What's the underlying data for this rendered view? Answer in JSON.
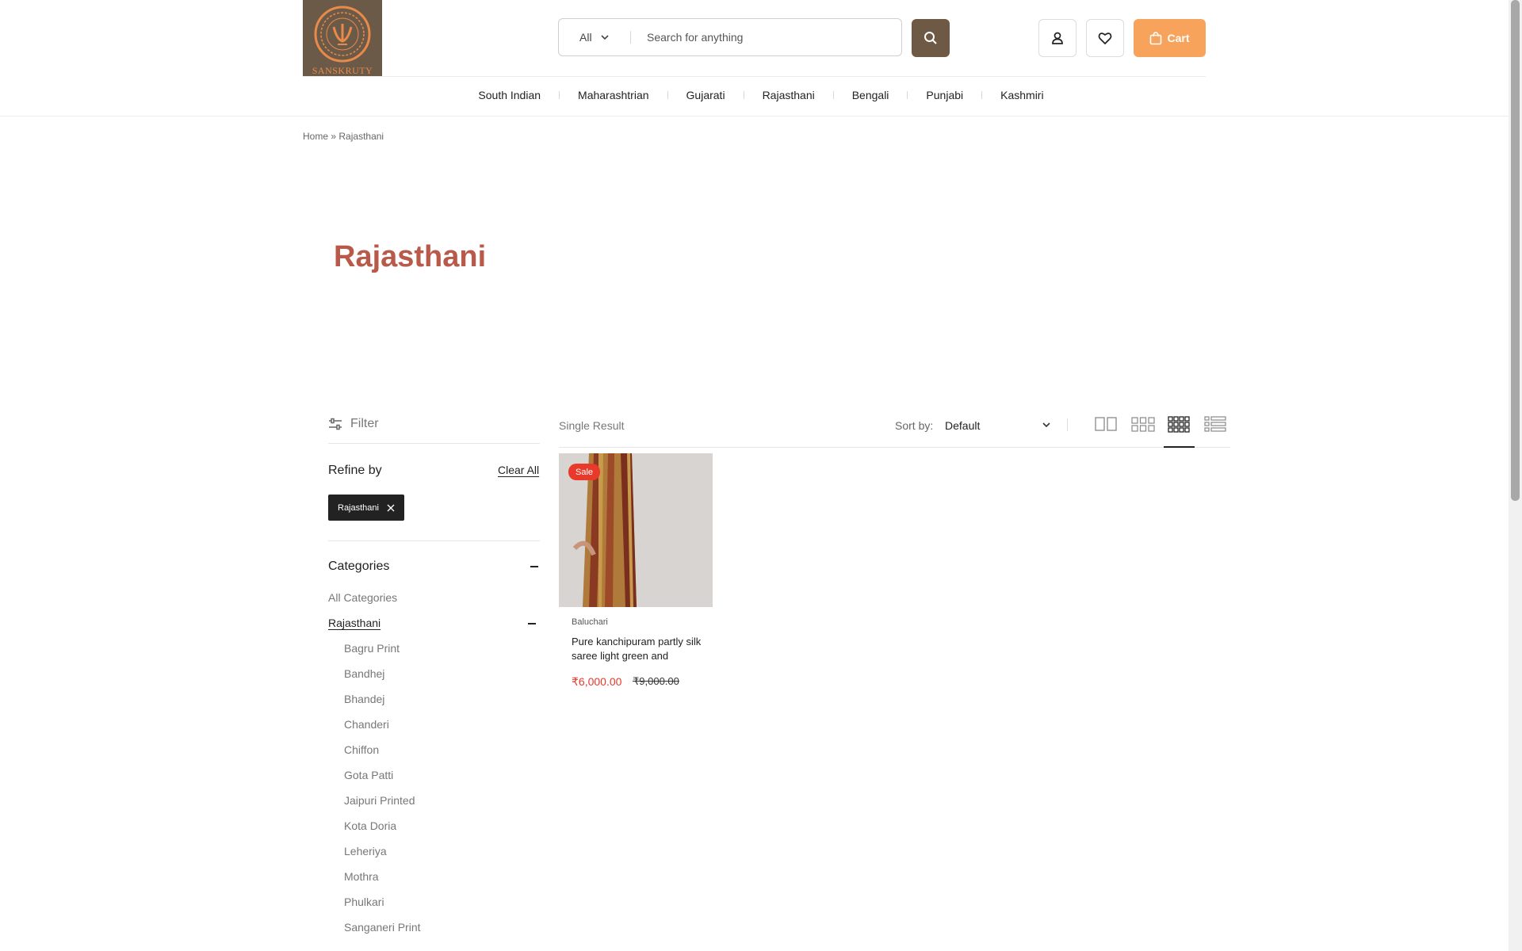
{
  "brand": {
    "logo_text": "SANSKRUTY"
  },
  "search": {
    "category": "All",
    "placeholder": "Search for anything"
  },
  "header": {
    "cart_label": "Cart"
  },
  "nav": [
    "South Indian",
    "Maharashtrian",
    "Gujarati",
    "Rajasthani",
    "Bengali",
    "Punjabi",
    "Kashmiri"
  ],
  "breadcrumb": {
    "home": "Home",
    "separator": "»",
    "current": "Rajasthani"
  },
  "page": {
    "title": "Rajasthani"
  },
  "sidebar": {
    "filter_label": "Filter",
    "refine_label": "Refine by",
    "clear_all": "Clear All",
    "active_chip": "Rajasthani",
    "categories_label": "Categories",
    "all_categories": "All Categories",
    "selected_category": "Rajasthani",
    "subcategories": [
      "Bagru Print",
      "Bandhej",
      "Bhandej",
      "Chanderi",
      "Chiffon",
      "Gota Patti",
      "Jaipuri Printed",
      "Kota Doria",
      "Leheriya",
      "Mothra",
      "Phulkari",
      "Sanganeri Print"
    ]
  },
  "toolbar": {
    "result_count": "Single Result",
    "sort_label": "Sort by:",
    "sort_value": "Default",
    "active_view": "grid-4"
  },
  "product": {
    "badge": "Sale",
    "brand": "Baluchari",
    "name": "Pure kanchipuram partly silk saree light green and",
    "price": "₹6,000.00",
    "old_price": "₹9,000.00"
  },
  "colors": {
    "accent": "#f7a35c",
    "brown": "#6e5a44",
    "title": "#b8594a",
    "sale": "#e8392b"
  }
}
